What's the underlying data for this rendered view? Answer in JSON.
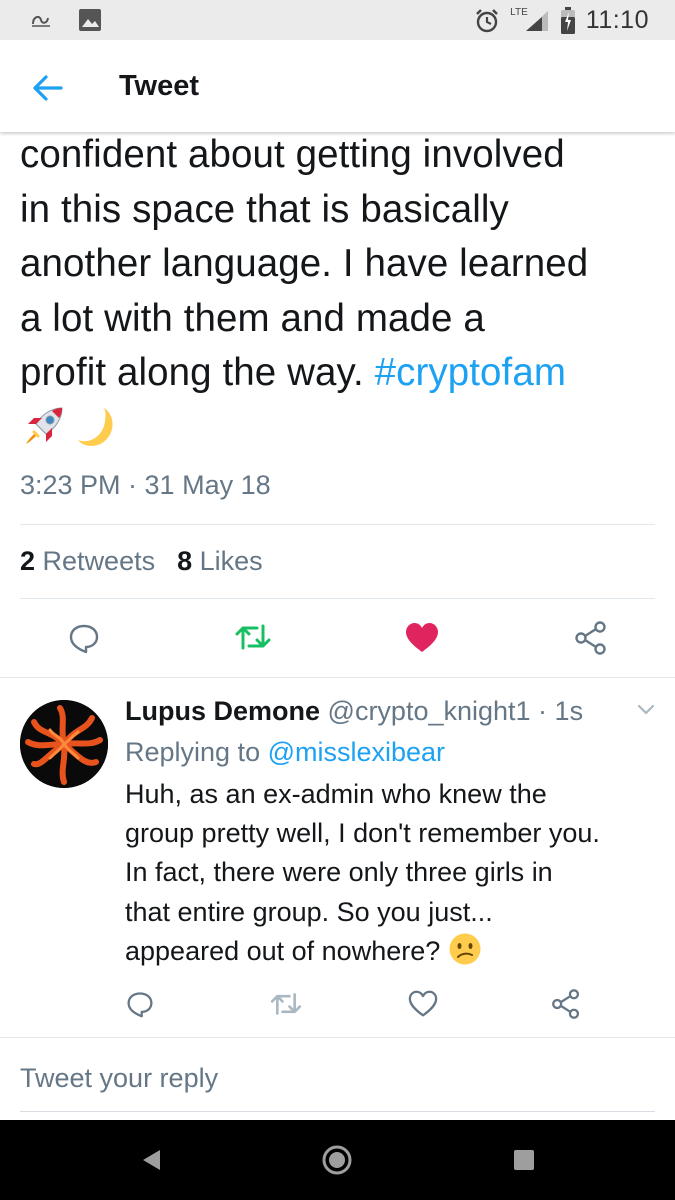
{
  "status_bar": {
    "time": "11:10",
    "network": "LTE",
    "icons": [
      "notification-icon",
      "image-icon",
      "alarm-icon",
      "signal-icon",
      "battery-icon"
    ]
  },
  "app_bar": {
    "title": "Tweet",
    "back_icon": "back-arrow-icon"
  },
  "tweet": {
    "text_lines": [
      "confident about getting involved",
      "in this space that is basically",
      "another language. I have learned",
      "a lot with them and made a"
    ],
    "last_line_text": "profit along the way. ",
    "hashtag": "#cryptofam",
    "emojis": [
      "rocket-emoji",
      "crescent-moon-emoji"
    ],
    "timestamp": "3:23 PM · 31 May 18",
    "retweets_count": "2",
    "retweets_label": "Retweets",
    "likes_count": "8",
    "likes_label": "Likes",
    "actions": [
      "reply-icon",
      "retweet-icon",
      "like-icon",
      "share-icon"
    ],
    "liked": true,
    "retweet_color": "#17bf63",
    "like_color": "#e0245e"
  },
  "reply": {
    "name": "Lupus Demone",
    "handle": "@crypto_knight1",
    "separator": " · ",
    "time": "1s",
    "replying_prefix": "Replying to ",
    "replying_to": "@misslexibear",
    "text_lines": [
      "Huh, as an ex-admin who knew the",
      "group pretty well, I don't remember you.",
      "In fact, there were only three girls in",
      "that entire group. So you just..."
    ],
    "last_line_text": "appeared out of nowhere? ",
    "emoji": "confused-face-emoji",
    "actions": [
      "reply-icon",
      "retweet-icon",
      "like-icon",
      "share-icon"
    ]
  },
  "compose": {
    "placeholder": "Tweet your reply"
  },
  "accent_color": "#1da1f2",
  "muted_color": "#657786"
}
